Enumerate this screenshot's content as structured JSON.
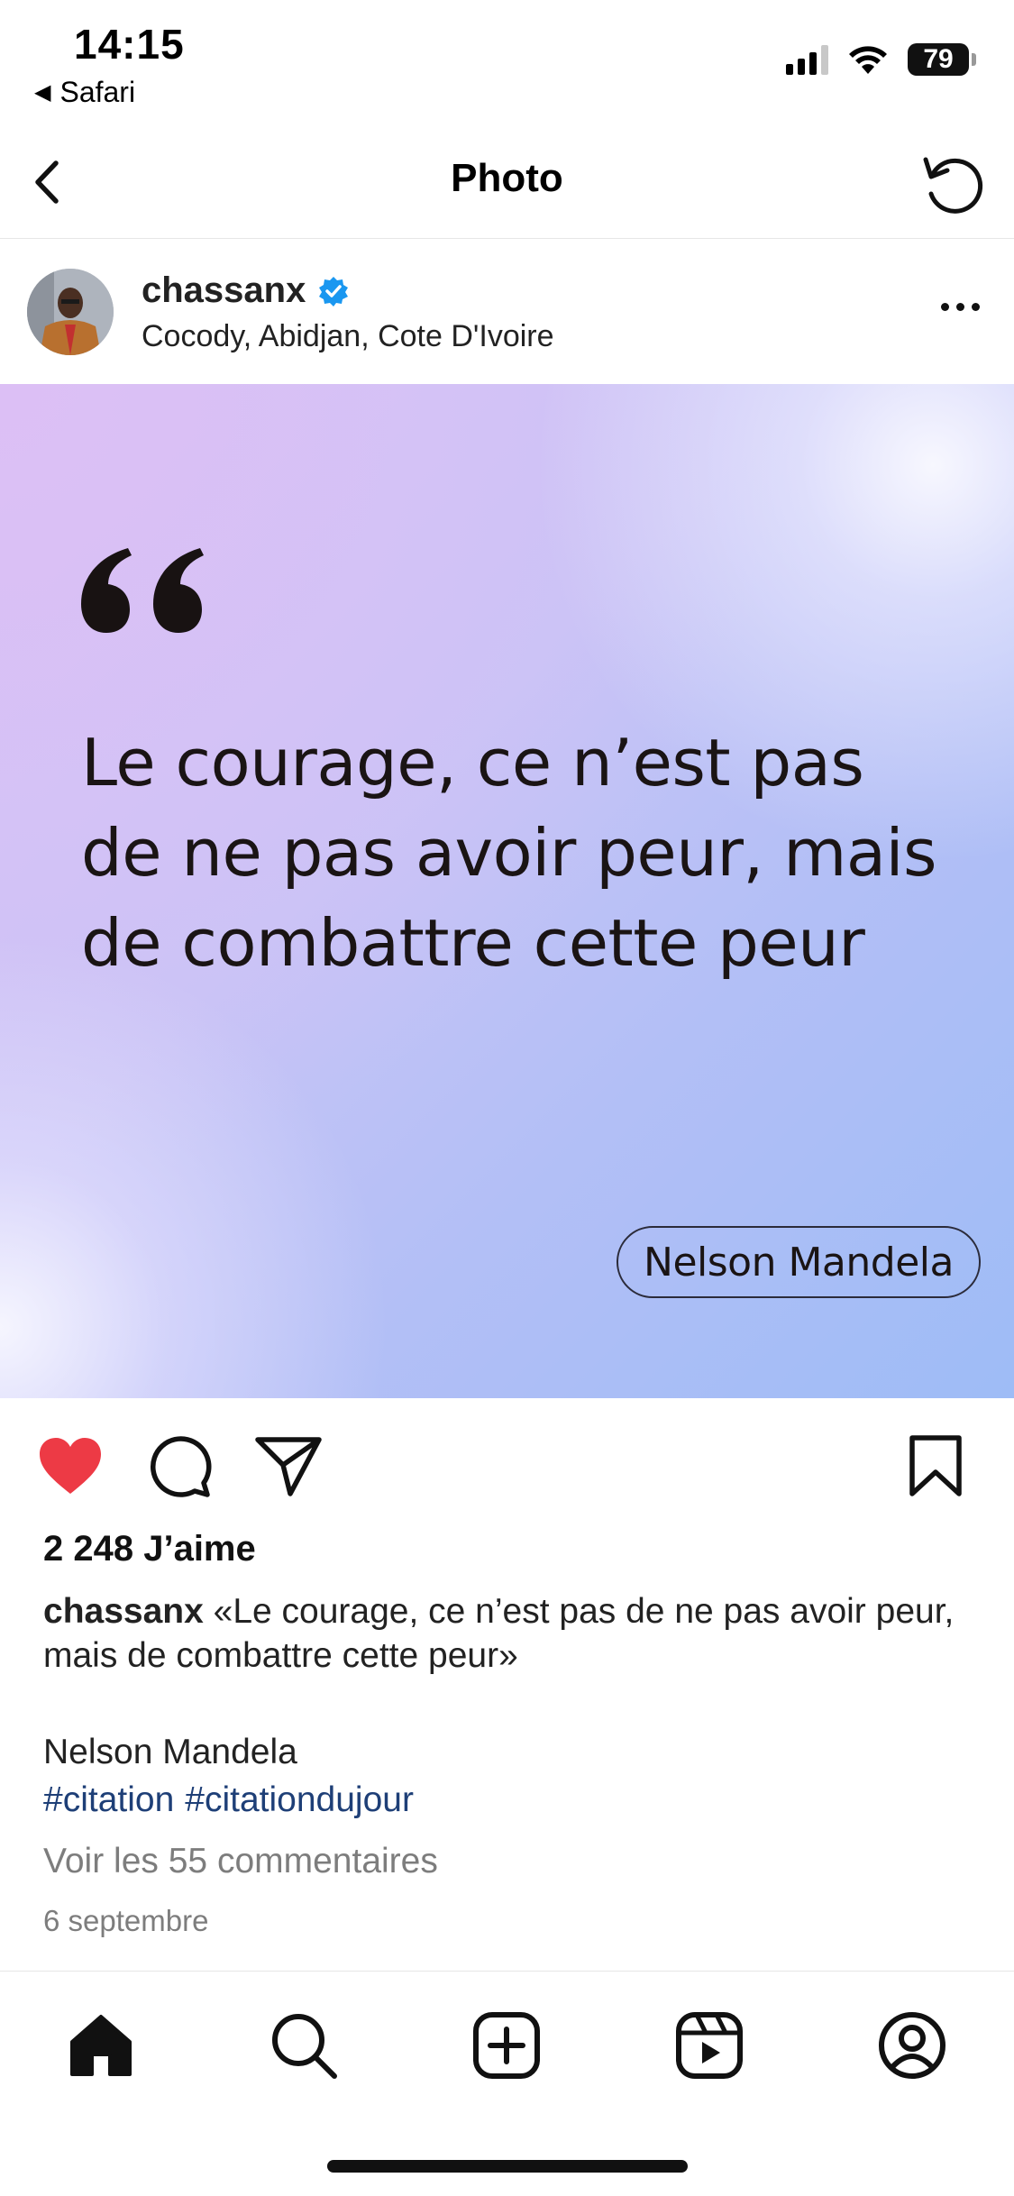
{
  "status_bar": {
    "time": "14:15",
    "back_app": "Safari",
    "battery": "79"
  },
  "nav": {
    "title": "Photo"
  },
  "post": {
    "username": "chassanx",
    "location": "Cocody, Abidjan, Cote D'Ivoire",
    "image": {
      "quote": "Le courage, ce n’est pas de ne pas avoir peur, mais de combattre cette peur",
      "author": "Nelson Mandela"
    },
    "likes": "2 248 J’aime",
    "caption": "«Le courage, ce n’est pas de ne pas avoir peur, mais de combattre cette peur»",
    "caption_author": "Nelson Mandela",
    "hashtags": [
      "#citation",
      "#citationdujour"
    ],
    "comments_link": "Voir les 55 commentaires",
    "date": "6 septembre",
    "liked": true
  },
  "colors": {
    "like_red": "#ed3a45",
    "hashtag_blue": "#1e3f77",
    "verified_blue": "#1a97f0"
  },
  "icons": {
    "header": [
      "back-arrow-icon",
      "refresh-icon",
      "more-icon",
      "verified-icon"
    ],
    "actions": [
      "heart-icon",
      "comment-icon",
      "share-icon",
      "bookmark-icon"
    ],
    "tabs": [
      "home-icon",
      "search-icon",
      "create-icon",
      "reels-icon",
      "profile-icon"
    ]
  }
}
